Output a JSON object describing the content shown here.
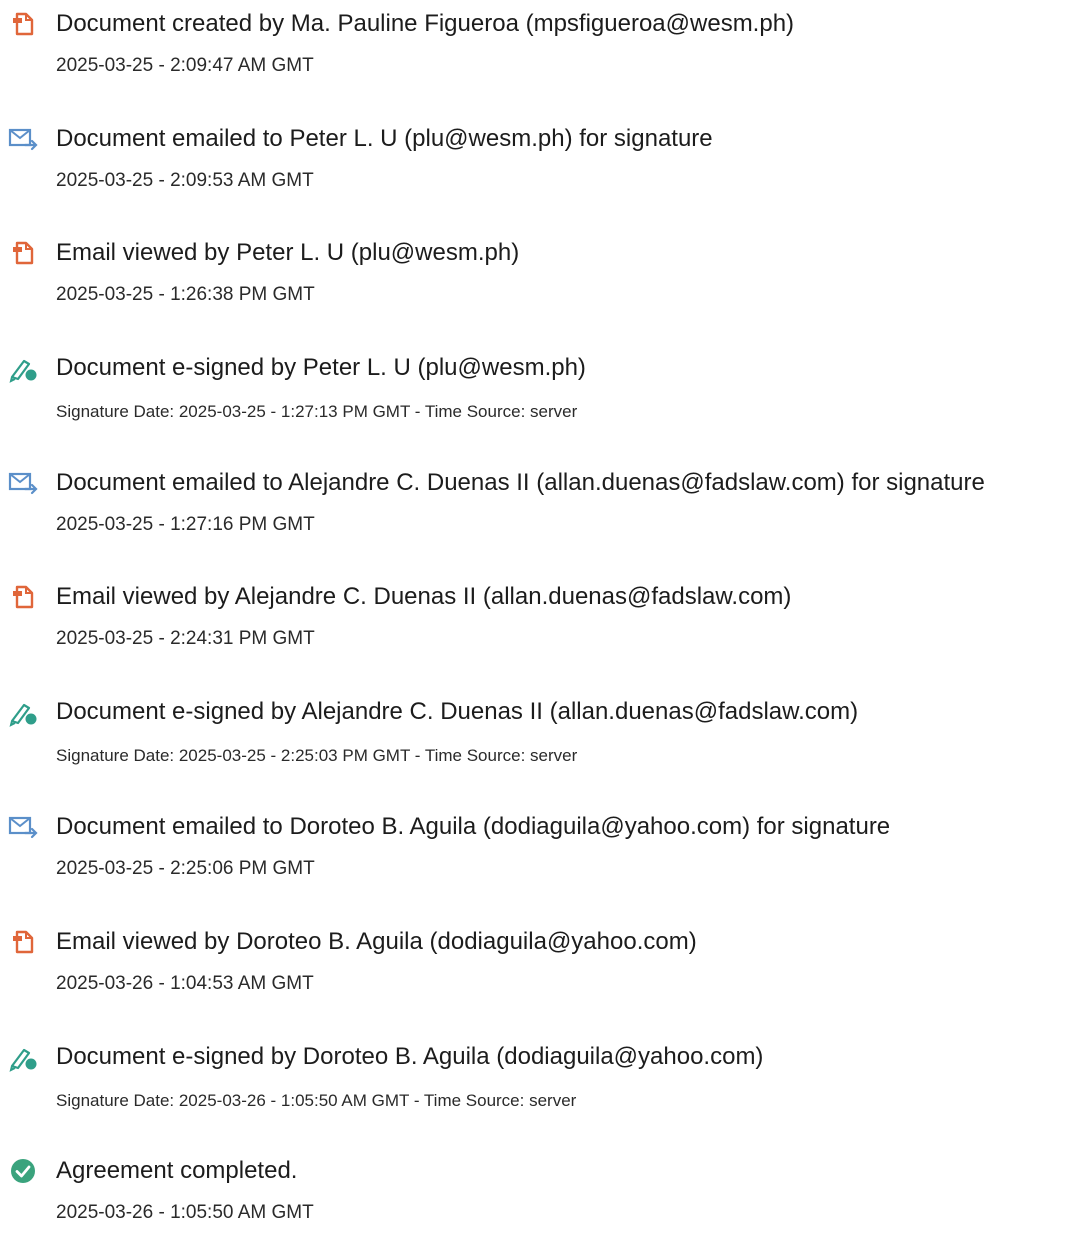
{
  "colors": {
    "doc_icon": "#e0663a",
    "email_icon": "#5b8fc9",
    "sign_icon": "#2f9e8a",
    "complete_icon": "#3aa37d"
  },
  "events": [
    {
      "icon": "document-icon",
      "text": "Document created by Ma. Pauline Figueroa (mpsfigueroa@wesm.ph)",
      "meta": "2025-03-25 - 2:09:47 AM GMT"
    },
    {
      "icon": "email-sent-icon",
      "text": "Document emailed to Peter L. U (plu@wesm.ph) for signature",
      "meta": "2025-03-25 - 2:09:53 AM GMT"
    },
    {
      "icon": "document-icon",
      "text": "Email viewed by Peter L. U (plu@wesm.ph)",
      "meta": "2025-03-25 - 1:26:38 PM GMT"
    },
    {
      "icon": "pen-sign-icon",
      "text": "Document e-signed by Peter L. U (plu@wesm.ph)",
      "meta": "Signature Date: 2025-03-25 - 1:27:13 PM GMT - Time Source: server"
    },
    {
      "icon": "email-sent-icon",
      "text": "Document emailed to Alejandre C. Duenas II (allan.duenas@fadslaw.com) for signature",
      "meta": "2025-03-25 - 1:27:16 PM GMT"
    },
    {
      "icon": "document-icon",
      "text": "Email viewed by Alejandre C. Duenas II (allan.duenas@fadslaw.com)",
      "meta": "2025-03-25 - 2:24:31 PM GMT"
    },
    {
      "icon": "pen-sign-icon",
      "text": "Document e-signed by Alejandre C. Duenas II (allan.duenas@fadslaw.com)",
      "meta": "Signature Date: 2025-03-25 - 2:25:03 PM GMT - Time Source: server"
    },
    {
      "icon": "email-sent-icon",
      "text": "Document emailed to Doroteo B. Aguila (dodiaguila@yahoo.com) for signature",
      "meta": "2025-03-25 - 2:25:06 PM GMT"
    },
    {
      "icon": "document-icon",
      "text": "Email viewed by Doroteo B. Aguila (dodiaguila@yahoo.com)",
      "meta": "2025-03-26 - 1:04:53 AM GMT"
    },
    {
      "icon": "pen-sign-icon",
      "text": "Document e-signed by Doroteo B. Aguila (dodiaguila@yahoo.com)",
      "meta": "Signature Date: 2025-03-26 - 1:05:50 AM GMT - Time Source: server"
    },
    {
      "icon": "check-circle-icon",
      "text": "Agreement completed.",
      "meta": "2025-03-26 - 1:05:50 AM GMT"
    }
  ]
}
